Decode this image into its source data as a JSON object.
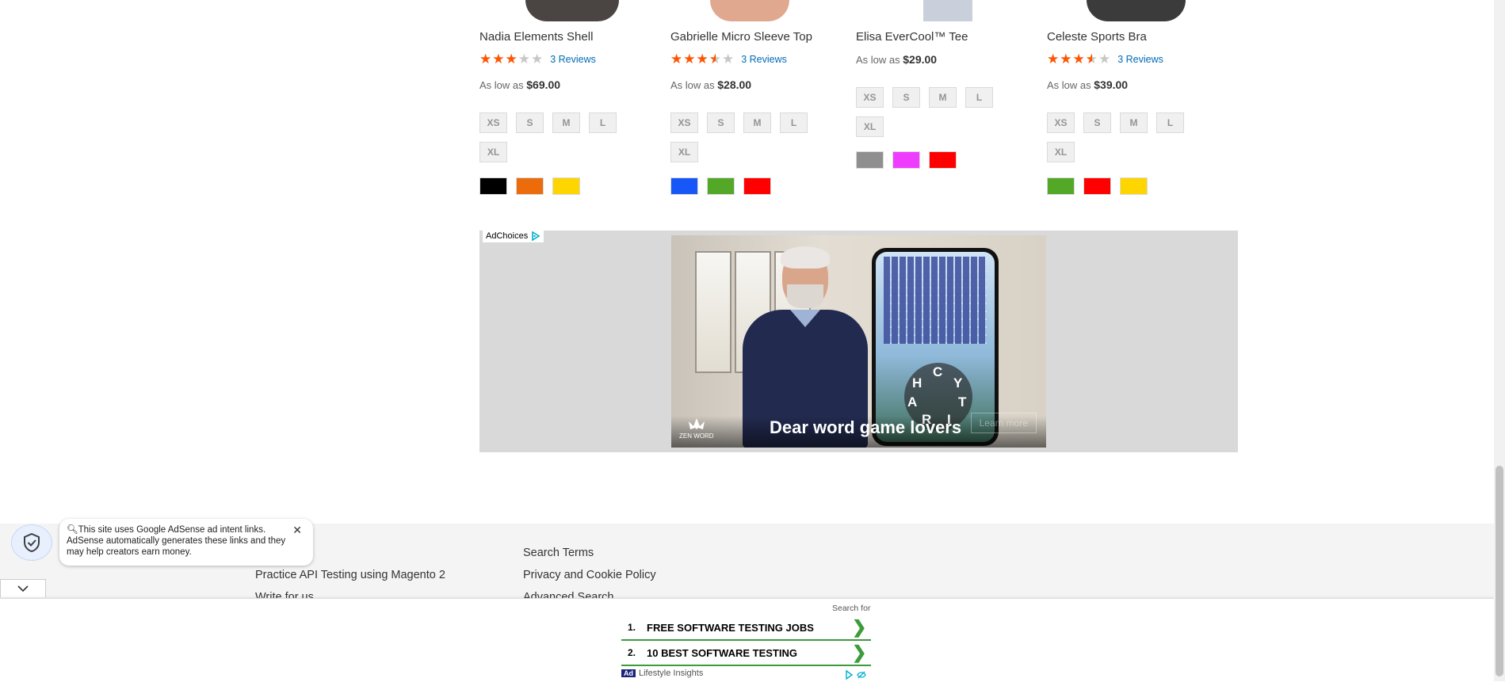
{
  "products": [
    {
      "name": "Nadia Elements Shell",
      "rating": 60,
      "reviews": "3 Reviews",
      "price_prefix": "As low as",
      "price": "$69.00",
      "sizes": [
        "XS",
        "S",
        "M",
        "L",
        "XL"
      ],
      "colors": [
        "#000000",
        "#ec6b0b",
        "#ffd500"
      ]
    },
    {
      "name": "Gabrielle Micro Sleeve Top",
      "rating": 70,
      "reviews": "3 Reviews",
      "price_prefix": "As low as",
      "price": "$28.00",
      "sizes": [
        "XS",
        "S",
        "M",
        "L",
        "XL"
      ],
      "colors": [
        "#1857f7",
        "#53a828",
        "#ff0000"
      ]
    },
    {
      "name": "Elisa EverCool™ Tee",
      "price_prefix": "As low as",
      "price": "$29.00",
      "sizes": [
        "XS",
        "S",
        "M",
        "L",
        "XL"
      ],
      "colors": [
        "#8f8f8f",
        "#ef3dff",
        "#ff0000"
      ]
    },
    {
      "name": "Celeste Sports Bra",
      "rating": 70,
      "reviews": "3 Reviews",
      "price_prefix": "As low as",
      "price": "$39.00",
      "sizes": [
        "XS",
        "S",
        "M",
        "L",
        "XL"
      ],
      "colors": [
        "#53a828",
        "#ff0000",
        "#ffd500"
      ]
    }
  ],
  "ad": {
    "adchoices": "AdChoices",
    "caption": "Dear word game lovers",
    "logo": "ZEN WORD",
    "learn_more": "Learn more",
    "wheel_letters": [
      "C",
      "H",
      "Y",
      "A",
      "T",
      "R",
      "I"
    ]
  },
  "footer": {
    "links_left": [
      "Practice API Testing using Magento 2",
      "Write for us"
    ],
    "links_right": [
      "Search Terms",
      "Privacy and Cookie Policy",
      "Advanced Search"
    ]
  },
  "notice": {
    "text": "This site uses Google AdSense ad intent links. AdSense automatically generates these links and they may help creators earn money.",
    "close": "✕"
  },
  "bottom_ad": {
    "label": "Search for",
    "items": [
      {
        "num": "1.",
        "text": "FREE SOFTWARE TESTING JOBS"
      },
      {
        "num": "2.",
        "text": "10 BEST SOFTWARE TESTING"
      }
    ],
    "ad_mark": "Ad",
    "sponsor": "Lifestyle Insights"
  },
  "colors": {
    "star": "#ff5501",
    "link": "#006bb4",
    "ad_green": "#3b9c3b"
  }
}
